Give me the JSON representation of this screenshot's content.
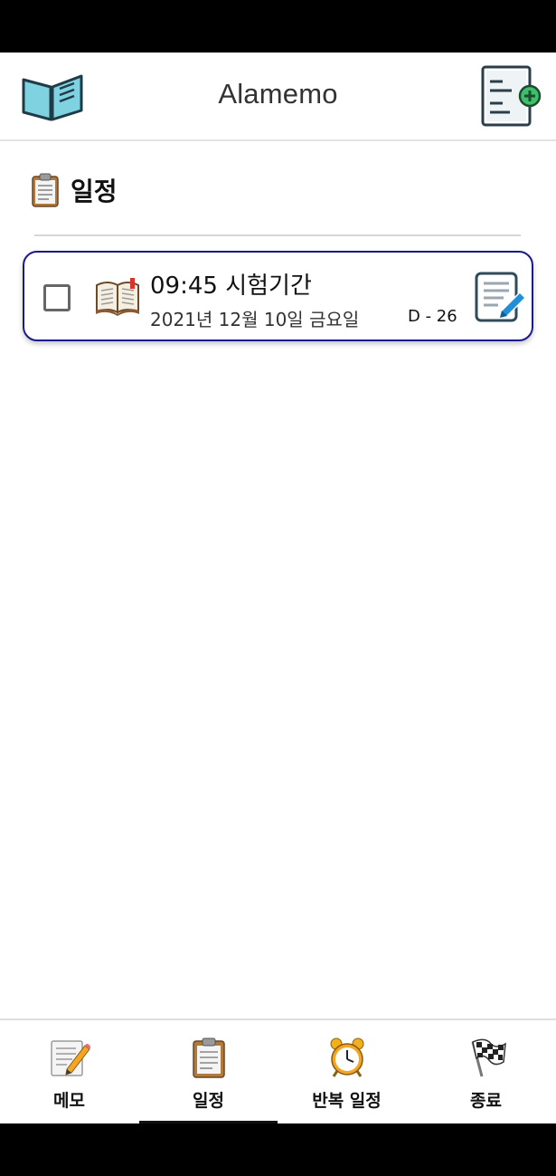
{
  "app": {
    "title": "Alamemo"
  },
  "section": {
    "title": "일정"
  },
  "schedules": [
    {
      "time_title": "09:45 시험기간",
      "date": "2021년 12월 10일 금요일",
      "dday": "D - 26",
      "checked": false
    }
  ],
  "tabs": [
    {
      "label": "메모",
      "icon": "memo-pencil-icon"
    },
    {
      "label": "일정",
      "icon": "clipboard-icon",
      "selected": true
    },
    {
      "label": "반복 일정",
      "icon": "alarm-clock-icon"
    },
    {
      "label": "종료",
      "icon": "checkered-flag-icon"
    }
  ],
  "colors": {
    "card_border": "#1a1a8c",
    "book_cover": "#7fd3e0",
    "add_accent": "#3cc06a",
    "edit_accent": "#1e8fd8"
  }
}
